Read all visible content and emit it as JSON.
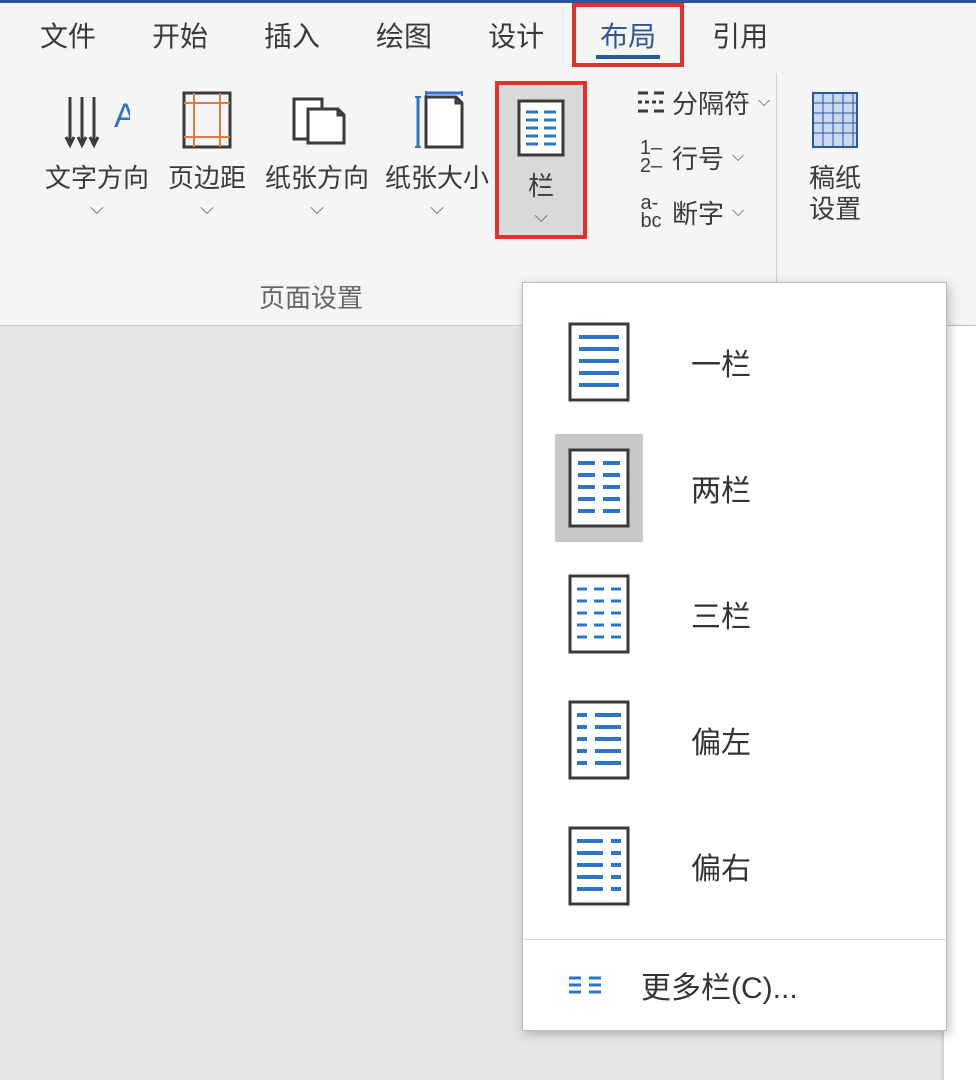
{
  "tabs": {
    "file": "文件",
    "home": "开始",
    "insert": "插入",
    "draw": "绘图",
    "design": "设计",
    "layout": "布局",
    "references": "引用"
  },
  "ribbon": {
    "text_direction": "文字方向",
    "margins": "页边距",
    "orientation": "纸张方向",
    "size": "纸张大小",
    "columns": "栏",
    "breaks": "分隔符",
    "line_numbers": "行号",
    "hyphenation": "断字",
    "page_setup_label": "页面设置",
    "manuscript_paper": "稿纸\n设置",
    "manuscript_label": "稿纸"
  },
  "dropdown": {
    "one": "一栏",
    "two": "两栏",
    "three": "三栏",
    "left": "偏左",
    "right": "偏右",
    "more": "更多栏(C)..."
  }
}
